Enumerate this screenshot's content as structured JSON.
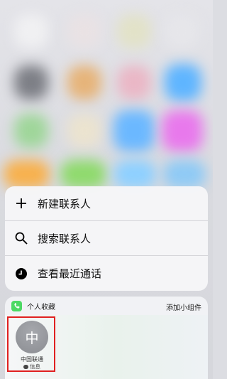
{
  "menu": {
    "items": [
      {
        "label": "新建联系人",
        "icon": "plus-icon"
      },
      {
        "label": "搜索联系人",
        "icon": "search-icon"
      },
      {
        "label": "查看最近通话",
        "icon": "clock-icon"
      }
    ]
  },
  "widget": {
    "title": "个人收藏",
    "add_label": "添加小组件",
    "app_icon": "phone-icon",
    "contact": {
      "avatar_text": "中",
      "name": "中国联通",
      "method": "信息",
      "method_icon": "message-icon"
    }
  },
  "colors": {
    "highlight": "#e02020",
    "phone_badge": "#4cd964",
    "avatar": "#8b8d92"
  }
}
